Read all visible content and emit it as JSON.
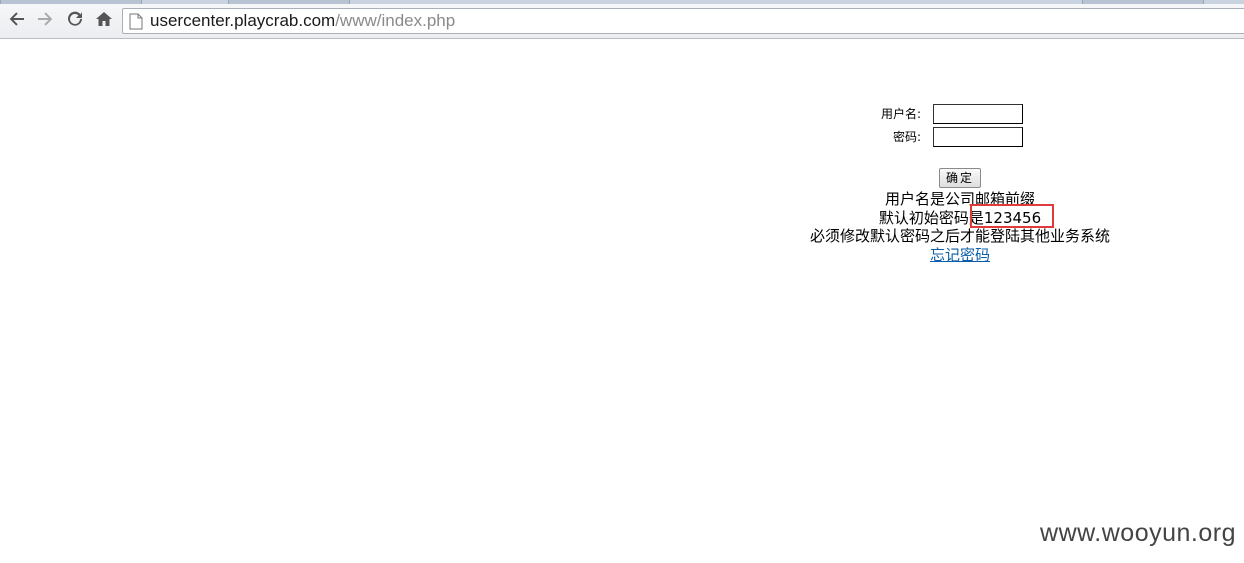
{
  "browser": {
    "url_host": "usercenter.playcrab.com",
    "url_path": "/www/index.php",
    "icons": [
      "back-arrow-icon",
      "forward-arrow-icon",
      "reload-icon",
      "home-icon",
      "page-icon"
    ]
  },
  "login": {
    "username_label": "用户名:",
    "password_label": "密码:",
    "username_value": "",
    "password_value": "",
    "submit_label": "确定"
  },
  "notice": {
    "line1": "用户名是公司邮箱前缀",
    "line2": "默认初始密码是123456",
    "line3": "必须修改默认密码之后才能登陆其他业务系统",
    "forgot_link": "忘记密码"
  },
  "watermark": "www.wooyun.org",
  "colors": {
    "highlight_box": "#e03a3a",
    "link": "#0b5ea8"
  }
}
